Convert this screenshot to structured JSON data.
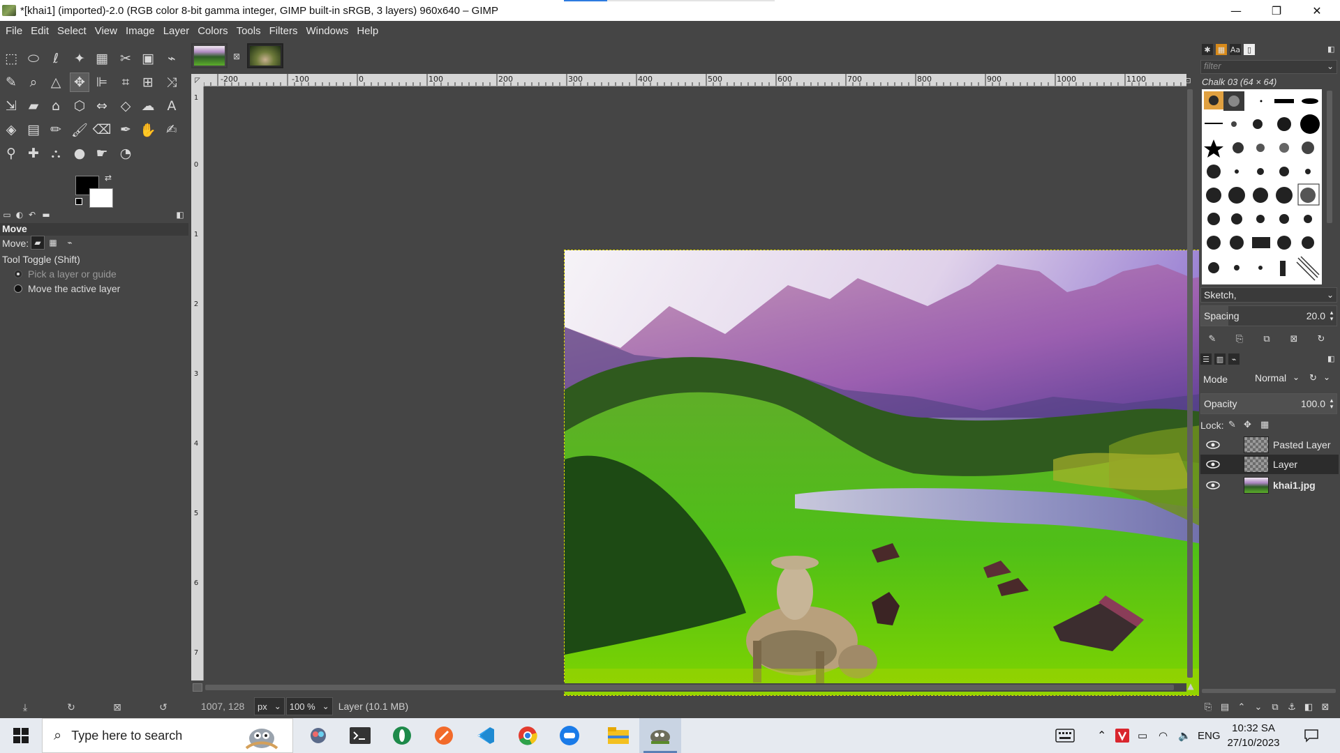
{
  "window": {
    "title": "*[khai1] (imported)-2.0 (RGB color 8-bit gamma integer, GIMP built-in sRGB, 3 layers) 960x640 – GIMP",
    "minimize": "—",
    "maximize": "❐",
    "close": "✕"
  },
  "menu": [
    "File",
    "Edit",
    "Select",
    "View",
    "Image",
    "Layer",
    "Colors",
    "Tools",
    "Filters",
    "Windows",
    "Help"
  ],
  "tool_options": {
    "title": "Move",
    "move_label": "Move:",
    "toggle_label": "Tool Toggle  (Shift)",
    "option_1": "Pick a layer or guide",
    "option_2": "Move the active layer"
  },
  "rulers": {
    "top": [
      "-200",
      "-100",
      "0",
      "100",
      "200",
      "300",
      "400",
      "500",
      "600",
      "700",
      "800",
      "900",
      "1000",
      "1100"
    ],
    "left": [
      "1",
      "0",
      "1",
      "2",
      "3",
      "4",
      "5",
      "6",
      "7"
    ]
  },
  "status": {
    "coords": "1007, 128",
    "unit": "px",
    "zoom": "100 %",
    "layer_info": "Layer (10.1 MB)"
  },
  "brushes": {
    "filter_placeholder": "filter",
    "current_brush": "Chalk 03 (64 × 64)",
    "tag": "Sketch,",
    "spacing_label": "Spacing",
    "spacing_value": "20.0",
    "spacing_fraction": 0.2
  },
  "layers": {
    "mode_label": "Mode",
    "mode_value": "Normal",
    "opacity_label": "Opacity",
    "opacity_value": "100.0",
    "opacity_fraction": 1.0,
    "lock_label": "Lock:",
    "items": [
      {
        "name": "Pasted Layer",
        "visible": true,
        "active": false,
        "bold": false
      },
      {
        "name": "Layer",
        "visible": true,
        "active": true,
        "bold": false
      },
      {
        "name": "khai1.jpg",
        "visible": true,
        "active": false,
        "bold": true
      }
    ]
  },
  "taskbar": {
    "search_placeholder": "Type here to search",
    "language": "ENG",
    "time": "10:32 SA",
    "date": "27/10/2023"
  },
  "colors": {
    "foreground": "#000000",
    "background": "#ffffff",
    "accent": "#2d7be0"
  }
}
